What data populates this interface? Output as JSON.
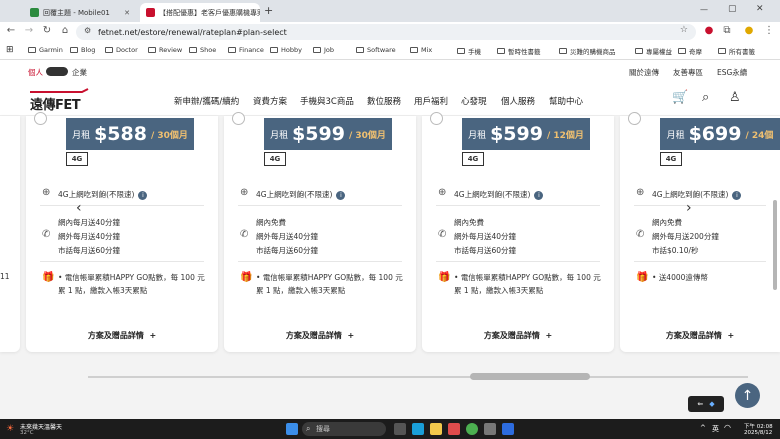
{
  "browser": {
    "tabs": [
      {
        "label": "回覆主題 - Mobile01",
        "active": false
      },
      {
        "label": "【搭配優惠】老客戶優惠購機專案",
        "active": true
      }
    ],
    "url": "fetnet.net/estore/renewal/rateplan#plan-select",
    "bookmarks": [
      "Garmin",
      "Blog",
      "Doctor",
      "Review",
      "Shoe",
      "Finance",
      "Hobby",
      "Job",
      "Software",
      "Mix",
      "手機",
      "暫時性書籤",
      "災難的購機商品",
      "專屬權益",
      "奇摩",
      "牛仔褲",
      "聘僱看護"
    ],
    "all_bookmarks_label": "所有書籤"
  },
  "site": {
    "toggle_left": "個人",
    "toggle_right": "企業",
    "top_links": [
      "關於遠傳",
      "友善專區",
      "ESG永續"
    ],
    "logo": "遠傳FET",
    "nav": [
      "新申辦/攜碼/續約",
      "資費方案",
      "手機與3C商品",
      "數位服務",
      "用戶福利",
      "心發現",
      "個人服務",
      "幫助中心"
    ]
  },
  "plans": [
    {
      "month_label": "月租",
      "price": "$588",
      "duration": "/ 30個月",
      "network": "4G",
      "data": "4G上網吃到飽(不限速)",
      "calls": [
        "網內每月送40分鐘",
        "網外每月送40分鐘",
        "市話每月送60分鐘"
      ],
      "gift": "電信帳單累積HAPPY GO點數，每 100 元累 1 點，繳款入帳3天累點",
      "detail": "方案及贈品詳情"
    },
    {
      "month_label": "月租",
      "price": "$599",
      "duration": "/ 30個月",
      "network": "4G",
      "data": "4G上網吃到飽(不限速)",
      "calls": [
        "網內免費",
        "網外每月送40分鐘",
        "市話每月送60分鐘"
      ],
      "gift": "電信帳單累積HAPPY GO點數，每 100 元累 1 點，繳款入帳3天累點",
      "detail": "方案及贈品詳情"
    },
    {
      "month_label": "月租",
      "price": "$599",
      "duration": "/ 12個月",
      "network": "4G",
      "data": "4G上網吃到飽(不限速)",
      "calls": [
        "網內免費",
        "網外每月送40分鐘",
        "市話每月送60分鐘"
      ],
      "gift": "電信帳單累積HAPPY GO點數，每 100 元累 1 點，繳款入帳3天累點",
      "detail": "方案及贈品詳情"
    },
    {
      "month_label": "月租",
      "price": "$699",
      "duration": "/ 24個",
      "network": "4G",
      "data": "4G上網吃到飽(不限速)",
      "calls": [
        "網內免費",
        "網外每月送200分鐘",
        "市話$0.10/秒"
      ],
      "gift": "送4000遠傳幣",
      "detail": "方案及贈品詳情"
    }
  ],
  "taskbar": {
    "weather": "未來幾天溫馨天",
    "temp": "32°C",
    "search": "搜尋",
    "lang": "英",
    "time": "下午 02:08",
    "date": "2025/8/12"
  },
  "colors": {
    "price_box": "#4a6580",
    "accent": "#f0c070",
    "logo_red": "#c8102e"
  }
}
